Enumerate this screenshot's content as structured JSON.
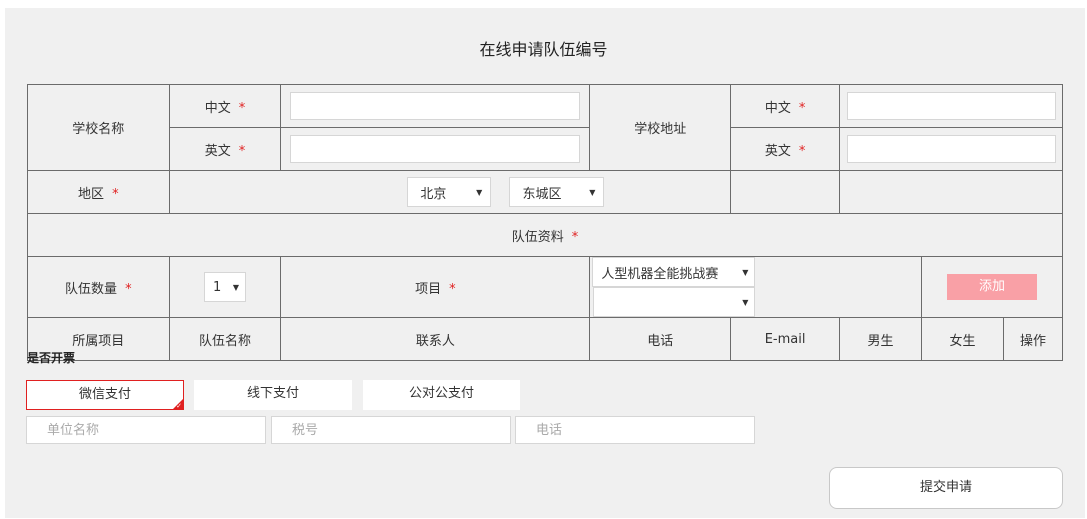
{
  "page": {
    "title": "在线申请队伍编号"
  },
  "form": {
    "school_name_label": "学校名称",
    "school_address_label": "学校地址",
    "chinese_label": "中文",
    "english_label": "英文",
    "required_mark": "*",
    "region_label": "地区",
    "region_city": "北京",
    "region_district": "东城区",
    "team_info_label": "队伍资料",
    "team_count_label": "队伍数量",
    "team_count_value": "1",
    "project_label": "项目",
    "project_value": "人型机器全能挑战赛",
    "project_sub_value": "",
    "add_button": "添加"
  },
  "team_table": {
    "columns": [
      "所属项目",
      "队伍名称",
      "联系人",
      "电话",
      "E-mail",
      "男生",
      "女生",
      "操作"
    ]
  },
  "invoice": {
    "label": "是否开票",
    "payment_options": [
      "微信支付",
      "线下支付",
      "公对公支付"
    ],
    "selected_payment": "微信支付",
    "company_name_placeholder": "单位名称",
    "tax_id_placeholder": "税号",
    "phone_placeholder": "电话"
  },
  "submit_button": "提交申请",
  "colors": {
    "required": "#e02020",
    "add_button_bg": "#f9a0a6",
    "panel_bg": "#f0f0f0",
    "border": "#6b6b6b"
  }
}
